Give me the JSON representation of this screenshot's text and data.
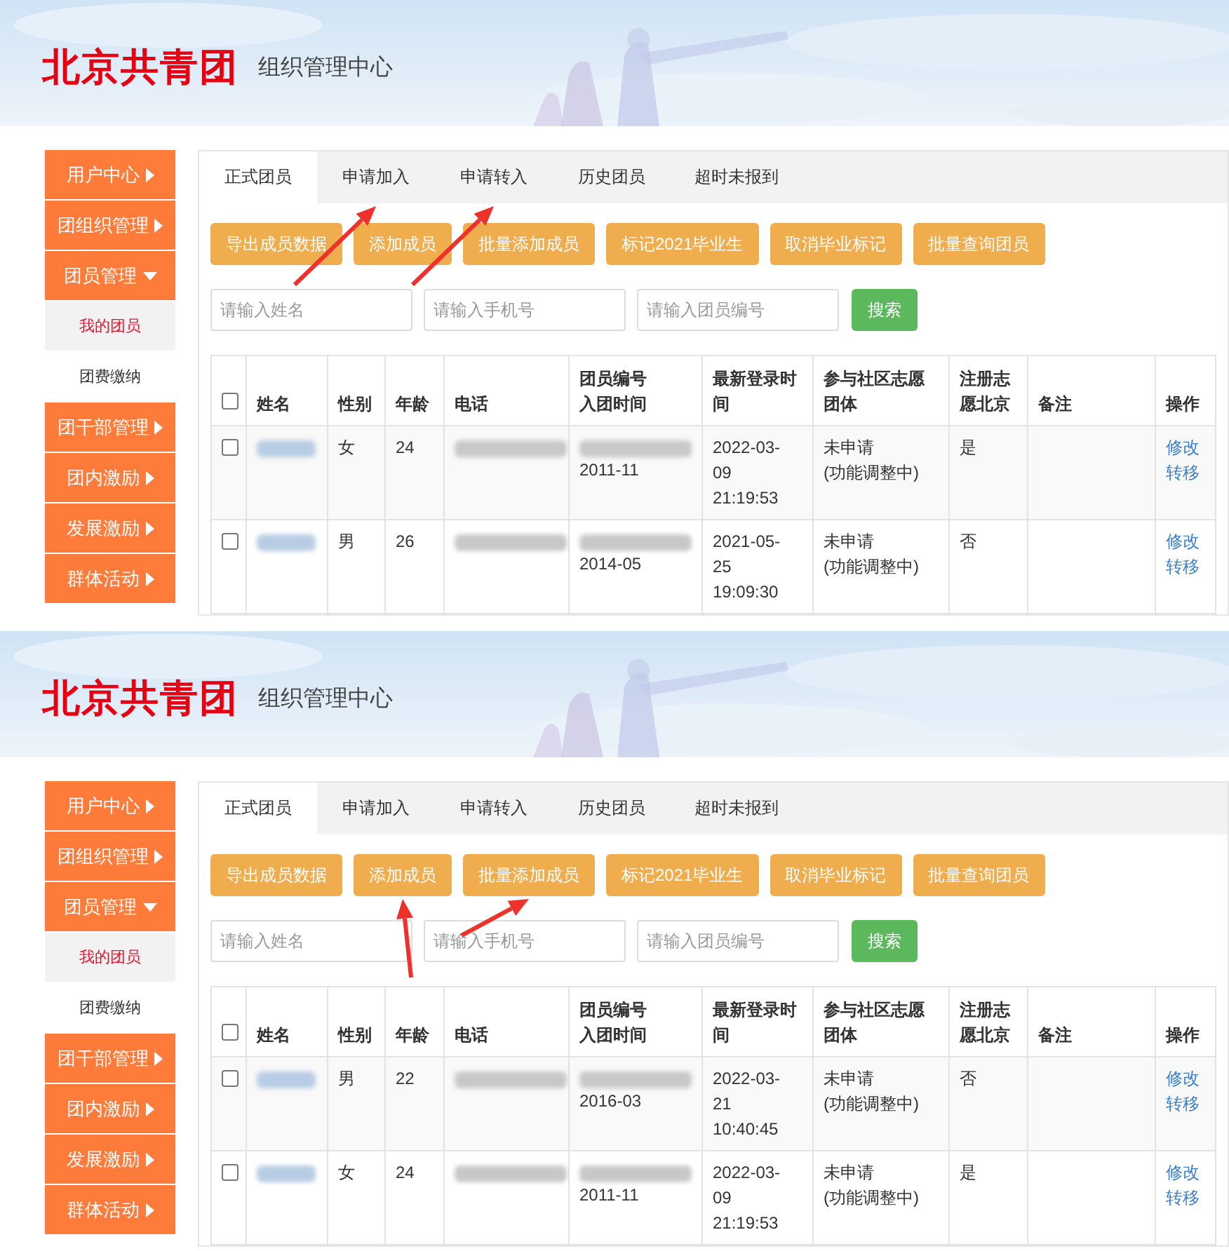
{
  "panels": [
    {
      "header": {
        "logo": "北京共青团",
        "subtitle": "组织管理中心"
      },
      "sidebar": [
        {
          "label": "用户中心",
          "expanded": false
        },
        {
          "label": "团组织管理",
          "expanded": false
        },
        {
          "label": "团员管理",
          "expanded": true,
          "children": [
            {
              "label": "我的团员",
              "selected": true
            },
            {
              "label": "团费缴纳",
              "selected": false
            }
          ]
        },
        {
          "label": "团干部管理",
          "expanded": false
        },
        {
          "label": "团内激励",
          "expanded": false
        },
        {
          "label": "发展激励",
          "expanded": false
        },
        {
          "label": "群体活动",
          "expanded": false
        }
      ],
      "tabs": [
        {
          "label": "正式团员",
          "selected": true,
          "arrow": false
        },
        {
          "label": "申请加入",
          "selected": false,
          "arrow": true
        },
        {
          "label": "申请转入",
          "selected": false,
          "arrow": true
        },
        {
          "label": "历史团员",
          "selected": false,
          "arrow": false
        },
        {
          "label": "超时未报到",
          "selected": false,
          "arrow": false
        }
      ],
      "buttons": [
        {
          "label": "导出成员数据",
          "arrow": false
        },
        {
          "label": "添加成员",
          "arrow": false
        },
        {
          "label": "批量添加成员",
          "arrow": false
        },
        {
          "label": "标记2021毕业生",
          "arrow": false
        },
        {
          "label": "取消毕业标记",
          "arrow": false
        },
        {
          "label": "批量查询团员",
          "arrow": false
        }
      ],
      "search_fields": [
        {
          "placeholder": "请输入姓名"
        },
        {
          "placeholder": "请输入手机号"
        },
        {
          "placeholder": "请输入团员编号"
        }
      ],
      "search_button": "搜索",
      "table": {
        "select_all_checked": false,
        "columns": [
          "姓名",
          "性别",
          "年龄",
          "电话",
          "团员编号入团时间",
          "最新登录时间",
          "参与社区志愿团体",
          "注册志愿北京",
          "备注",
          "操作"
        ],
        "rows": [
          {
            "checked": false,
            "name_blurred": true,
            "gender": "女",
            "age": "24",
            "phone_blurred": true,
            "member_no_blurred": true,
            "joined": "2011-11",
            "last_login": "2022-03-09 21:19:53",
            "volunteer_group": [
              "未申请",
              "(功能调整中)"
            ],
            "registered": "是",
            "actions": [
              "修改",
              "转移"
            ]
          },
          {
            "checked": false,
            "name_blurred": true,
            "gender": "男",
            "age": "26",
            "phone_blurred": true,
            "member_no_blurred": true,
            "joined": "2014-05",
            "last_login": "2021-05-25 19:09:30",
            "volunteer_group": [
              "未申请",
              "(功能调整中)"
            ],
            "registered": "否",
            "actions": [
              "修改",
              "转移"
            ]
          }
        ]
      }
    },
    {
      "header": {
        "logo": "北京共青团",
        "subtitle": "组织管理中心"
      },
      "sidebar": [
        {
          "label": "用户中心",
          "expanded": false
        },
        {
          "label": "团组织管理",
          "expanded": false
        },
        {
          "label": "团员管理",
          "expanded": true,
          "children": [
            {
              "label": "我的团员",
              "selected": true
            },
            {
              "label": "团费缴纳",
              "selected": false
            }
          ]
        },
        {
          "label": "团干部管理",
          "expanded": false
        },
        {
          "label": "团内激励",
          "expanded": false
        },
        {
          "label": "发展激励",
          "expanded": false
        },
        {
          "label": "群体活动",
          "expanded": false
        }
      ],
      "tabs": [
        {
          "label": "正式团员",
          "selected": true,
          "arrow": false
        },
        {
          "label": "申请加入",
          "selected": false,
          "arrow": false
        },
        {
          "label": "申请转入",
          "selected": false,
          "arrow": false
        },
        {
          "label": "历史团员",
          "selected": false,
          "arrow": false
        },
        {
          "label": "超时未报到",
          "selected": false,
          "arrow": false
        }
      ],
      "buttons": [
        {
          "label": "导出成员数据",
          "arrow": false
        },
        {
          "label": "添加成员",
          "arrow": true
        },
        {
          "label": "批量添加成员",
          "arrow": true
        },
        {
          "label": "标记2021毕业生",
          "arrow": false
        },
        {
          "label": "取消毕业标记",
          "arrow": false
        },
        {
          "label": "批量查询团员",
          "arrow": false
        }
      ],
      "search_fields": [
        {
          "placeholder": "请输入姓名"
        },
        {
          "placeholder": "请输入手机号"
        },
        {
          "placeholder": "请输入团员编号"
        }
      ],
      "search_button": "搜索",
      "table": {
        "select_all_checked": false,
        "columns": [
          "姓名",
          "性别",
          "年龄",
          "电话",
          "团员编号入团时间",
          "最新登录时间",
          "参与社区志愿团体",
          "注册志愿北京",
          "备注",
          "操作"
        ],
        "rows": [
          {
            "checked": false,
            "name_blurred": true,
            "gender": "男",
            "age": "22",
            "phone_blurred": true,
            "member_no_blurred": true,
            "joined": "2016-03",
            "last_login": "2022-03-21 10:40:45",
            "volunteer_group": [
              "未申请",
              "(功能调整中)"
            ],
            "registered": "否",
            "actions": [
              "修改",
              "转移"
            ]
          },
          {
            "checked": false,
            "name_blurred": true,
            "gender": "女",
            "age": "24",
            "phone_blurred": true,
            "member_no_blurred": true,
            "joined": "2011-11",
            "last_login": "2022-03-09 21:19:53",
            "volunteer_group": [
              "未申请",
              "(功能调整中)"
            ],
            "registered": "是",
            "actions": [
              "修改",
              "转移"
            ]
          }
        ]
      }
    }
  ]
}
